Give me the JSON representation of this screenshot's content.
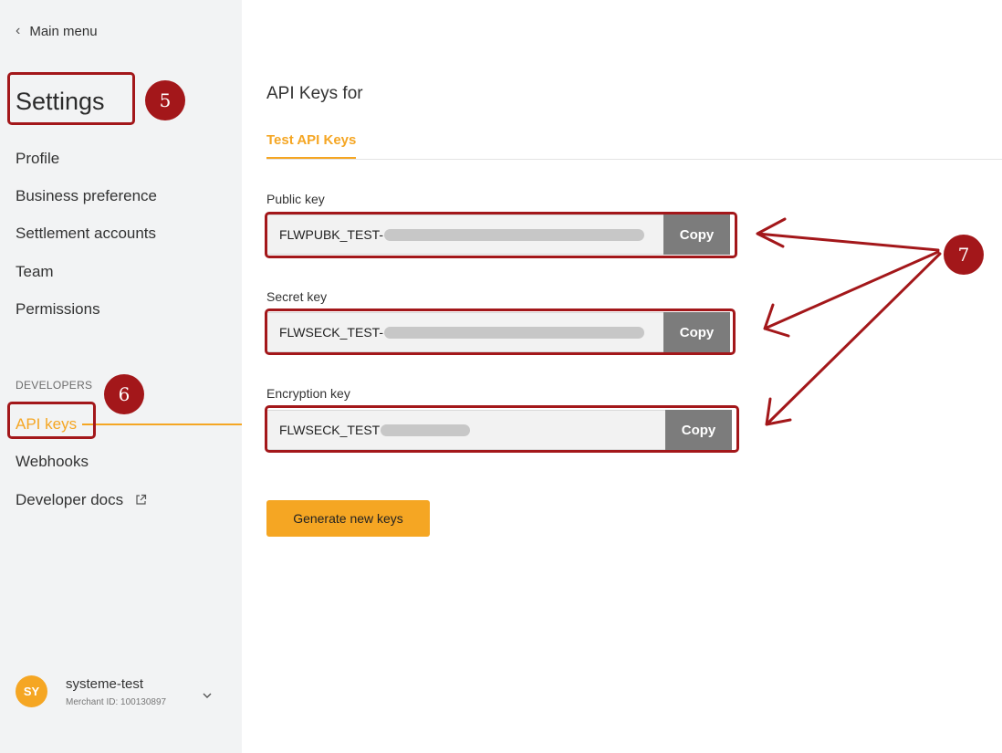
{
  "sidebar": {
    "back_label": "Main menu",
    "title": "Settings",
    "items": [
      {
        "label": "Profile"
      },
      {
        "label": "Business preference"
      },
      {
        "label": "Settlement accounts"
      },
      {
        "label": "Team"
      },
      {
        "label": "Permissions"
      }
    ],
    "developers_label": "DEVELOPERS",
    "dev_items": [
      {
        "label": "API keys",
        "active": true
      },
      {
        "label": "Webhooks"
      },
      {
        "label": "Developer docs"
      }
    ],
    "user": {
      "initials": "SY",
      "name": "systeme-test",
      "merchant_id": "Merchant ID: 100130897"
    }
  },
  "main": {
    "title": "API Keys for",
    "tab_label": "Test API Keys",
    "keys": [
      {
        "label": "Public key",
        "prefix": "FLWPUBK_TEST-",
        "copy_label": "Copy"
      },
      {
        "label": "Secret key",
        "prefix": "FLWSECK_TEST-",
        "copy_label": "Copy"
      },
      {
        "label": "Encryption key",
        "prefix": "FLWSECK_TEST",
        "copy_label": "Copy"
      }
    ],
    "generate_label": "Generate new keys"
  },
  "annotations": {
    "badge_settings": "5",
    "badge_api_keys": "6",
    "badge_keys": "7"
  },
  "colors": {
    "accent": "#f5a623",
    "annotation": "#a3171a",
    "copy_button": "#7c7c7c",
    "sidebar_bg": "#f2f3f4"
  }
}
